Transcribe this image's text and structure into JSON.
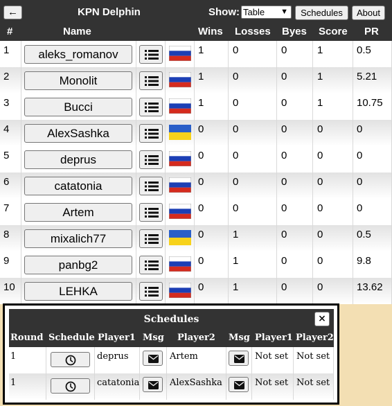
{
  "header": {
    "back_label": "←",
    "title": "KPN Delphin",
    "show_label": "Show:",
    "show_value": "Table",
    "schedules_label": "Schedules",
    "about_label": "About"
  },
  "columns": {
    "num": "#",
    "name": "Name",
    "wins": "Wins",
    "losses": "Losses",
    "byes": "Byes",
    "score": "Score",
    "pr": "PR"
  },
  "players": [
    {
      "num": "1",
      "name": "aleks_romanov",
      "flag": "russia-flag-icon",
      "wins": "1",
      "losses": "0",
      "byes": "0",
      "score": "1",
      "pr": "0.5"
    },
    {
      "num": "2",
      "name": "Monolit",
      "flag": "russia-flag-icon",
      "wins": "1",
      "losses": "0",
      "byes": "0",
      "score": "1",
      "pr": "5.21"
    },
    {
      "num": "3",
      "name": "Bucci",
      "flag": "russia-flag-icon",
      "wins": "1",
      "losses": "0",
      "byes": "0",
      "score": "1",
      "pr": "10.75"
    },
    {
      "num": "4",
      "name": "AlexSashka",
      "flag": "ukraine-flag-icon",
      "wins": "0",
      "losses": "0",
      "byes": "0",
      "score": "0",
      "pr": "0"
    },
    {
      "num": "5",
      "name": "deprus",
      "flag": "russia-flag-icon",
      "wins": "0",
      "losses": "0",
      "byes": "0",
      "score": "0",
      "pr": "0"
    },
    {
      "num": "6",
      "name": "catatonia",
      "flag": "russia-flag-icon",
      "wins": "0",
      "losses": "0",
      "byes": "0",
      "score": "0",
      "pr": "0"
    },
    {
      "num": "7",
      "name": "Artem",
      "flag": "russia-flag-icon",
      "wins": "0",
      "losses": "0",
      "byes": "0",
      "score": "0",
      "pr": "0"
    },
    {
      "num": "8",
      "name": "mixalich77",
      "flag": "ukraine-flag-icon",
      "wins": "0",
      "losses": "1",
      "byes": "0",
      "score": "0",
      "pr": "0.5"
    },
    {
      "num": "9",
      "name": "panbg2",
      "flag": "russia-flag-icon",
      "wins": "0",
      "losses": "1",
      "byes": "0",
      "score": "0",
      "pr": "9.8"
    },
    {
      "num": "10",
      "name": "LEHKA",
      "flag": "russia-flag-icon",
      "wins": "0",
      "losses": "1",
      "byes": "0",
      "score": "0",
      "pr": "13.62"
    }
  ],
  "schedules": {
    "title": "Schedules",
    "close_label": "×",
    "columns": [
      "Round",
      "Schedule",
      "Player1",
      "Msg",
      "Player2",
      "Msg",
      "Player1",
      "Player2"
    ],
    "rows": [
      {
        "round": "1",
        "player1": "deprus",
        "player2": "Artem",
        "status1": "Not set",
        "status2": "Not set"
      },
      {
        "round": "1",
        "player1": "catatonia",
        "player2": "AlexSashka",
        "status1": "Not set",
        "status2": "Not set"
      }
    ]
  },
  "colors": {
    "header_bg": "#333333",
    "page_bg": "#f3dfb3",
    "button_bg": "#efefef"
  }
}
